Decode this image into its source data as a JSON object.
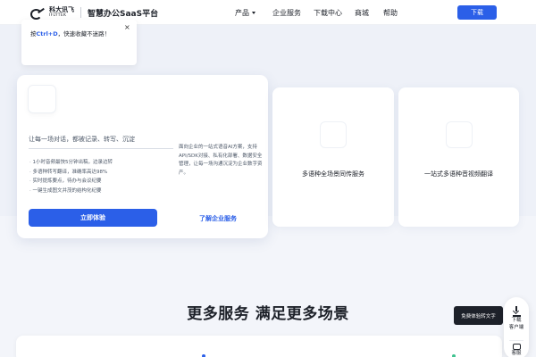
{
  "header": {
    "logo_cn": "科大讯飞",
    "logo_en": "IFLYTEK",
    "product_name": "智慧办公SaaS平台",
    "nav": [
      {
        "label": "产品",
        "has_caret": true
      },
      {
        "label": "企业服务"
      },
      {
        "label": "下载中心"
      },
      {
        "label": "商城"
      },
      {
        "label": "帮助"
      }
    ],
    "download_label": "下载"
  },
  "tooltip": {
    "prefix": "按",
    "shortcut": "Ctrl+D",
    "suffix": "，快速收藏不迷路！",
    "close_glyph": "×"
  },
  "main_card": {
    "input_placeholder": "让每一场对话，都被记录、转写、沉淀",
    "features": [
      "1小时音频最快5分钟出稿，边录边转",
      "多语种转写翻译，准确率高达98%",
      "实时提炼要点，待办与会议纪要",
      "一键生成图文并茂的结构化纪要"
    ],
    "description": "面向企业的一站式语音AI方案，支持API/SDK对接、私有化部署、数据安全管理，让每一场沟通沉淀为企业数字资产。",
    "try_button": "立即体验",
    "enterprise_link": "了解企业服务"
  },
  "side_cards": [
    {
      "label": "多语种全场景同传服务"
    },
    {
      "label": "一站式多语种音视频翻译"
    }
  ],
  "section": {
    "title": "更多服务 满足更多场景"
  },
  "float_bar": {
    "download_client": "下载\n客户端",
    "customer_service": "客服",
    "hover_tip": "免费体验转文字"
  },
  "colors": {
    "accent": "#2b5fe8",
    "text_primary": "#1d2129",
    "hero_bg": "#eef1f8"
  }
}
